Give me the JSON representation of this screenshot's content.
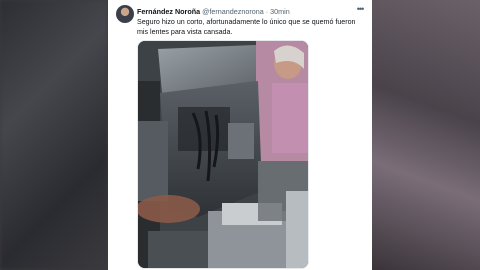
{
  "tweet": {
    "author_name": "Fernández Noroña",
    "handle": "@fernandeznorona",
    "separator": " · ",
    "time": "30min",
    "more_icon": "more-horizontal-icon",
    "text": "Seguro hizo un corto, afortunadamente lo único que se quemó fueron mis lentes para vista cansada."
  },
  "colors": {
    "background": "#3c3a3d",
    "card": "#ffffff",
    "text_primary": "#0f1419",
    "text_secondary": "#536471"
  }
}
